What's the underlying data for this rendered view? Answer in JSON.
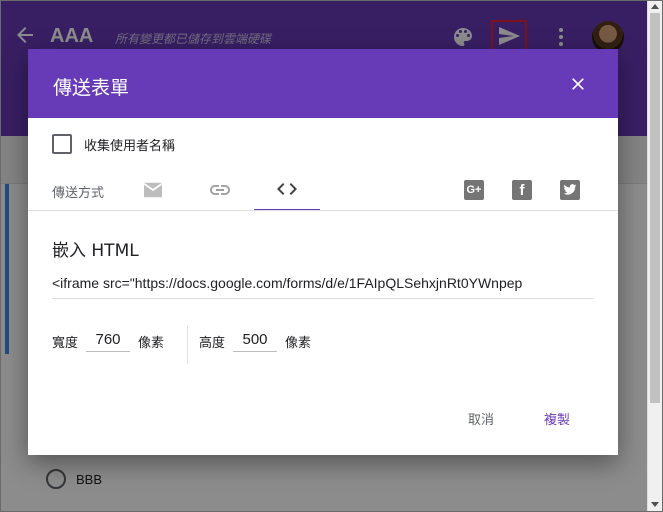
{
  "app": {
    "title": "AAA",
    "save_status": "所有變更都已儲存到雲端硬碟",
    "background_option": "BBB"
  },
  "icons": {
    "back": "arrow-back-icon",
    "palette": "palette-icon",
    "send": "send-icon",
    "more": "more-vert-icon",
    "close": "close-icon",
    "email": "email-icon",
    "link": "link-icon",
    "embed": "code-icon",
    "google_plus": "google-plus-icon",
    "facebook": "facebook-icon",
    "twitter": "twitter-icon"
  },
  "colors": {
    "accent": "#673ab7",
    "highlight_border": "#e5202e"
  },
  "dialog": {
    "title": "傳送表單",
    "collect_email_label": "收集使用者名稱",
    "collect_email_checked": false,
    "send_via_label": "傳送方式",
    "active_tab": "embed",
    "embed_heading": "嵌入 HTML",
    "embed_code": "<iframe src=\"https://docs.google.com/forms/d/e/1FAIpQLSehxjnRt0YWnpep",
    "width_label": "寬度",
    "width_value": "760",
    "width_unit": "像素",
    "height_label": "高度",
    "height_value": "500",
    "height_unit": "像素",
    "cancel_label": "取消",
    "copy_label": "複製"
  }
}
